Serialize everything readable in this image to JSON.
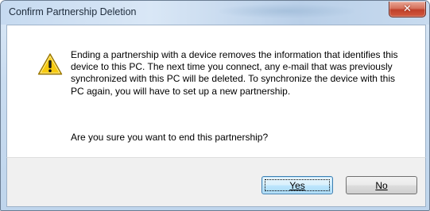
{
  "window": {
    "title": "Confirm Partnership Deletion",
    "close_glyph": "✕"
  },
  "dialog": {
    "icon": "warning-icon",
    "message": "Ending a partnership with a device removes the information that identifies this device to this PC. The next time you connect, any e-mail that was previously synchronized with this PC will be deleted. To synchronize the device with this PC again, you will have to set up a new partnership.",
    "question": "Are you sure you want to end this partnership?"
  },
  "buttons": {
    "yes_label": "Yes",
    "no_label": "No",
    "default": "yes"
  },
  "colors": {
    "warning_fill": "#f6c90e",
    "close_button": "#c0402a",
    "default_button_border": "#3c7fb1"
  }
}
